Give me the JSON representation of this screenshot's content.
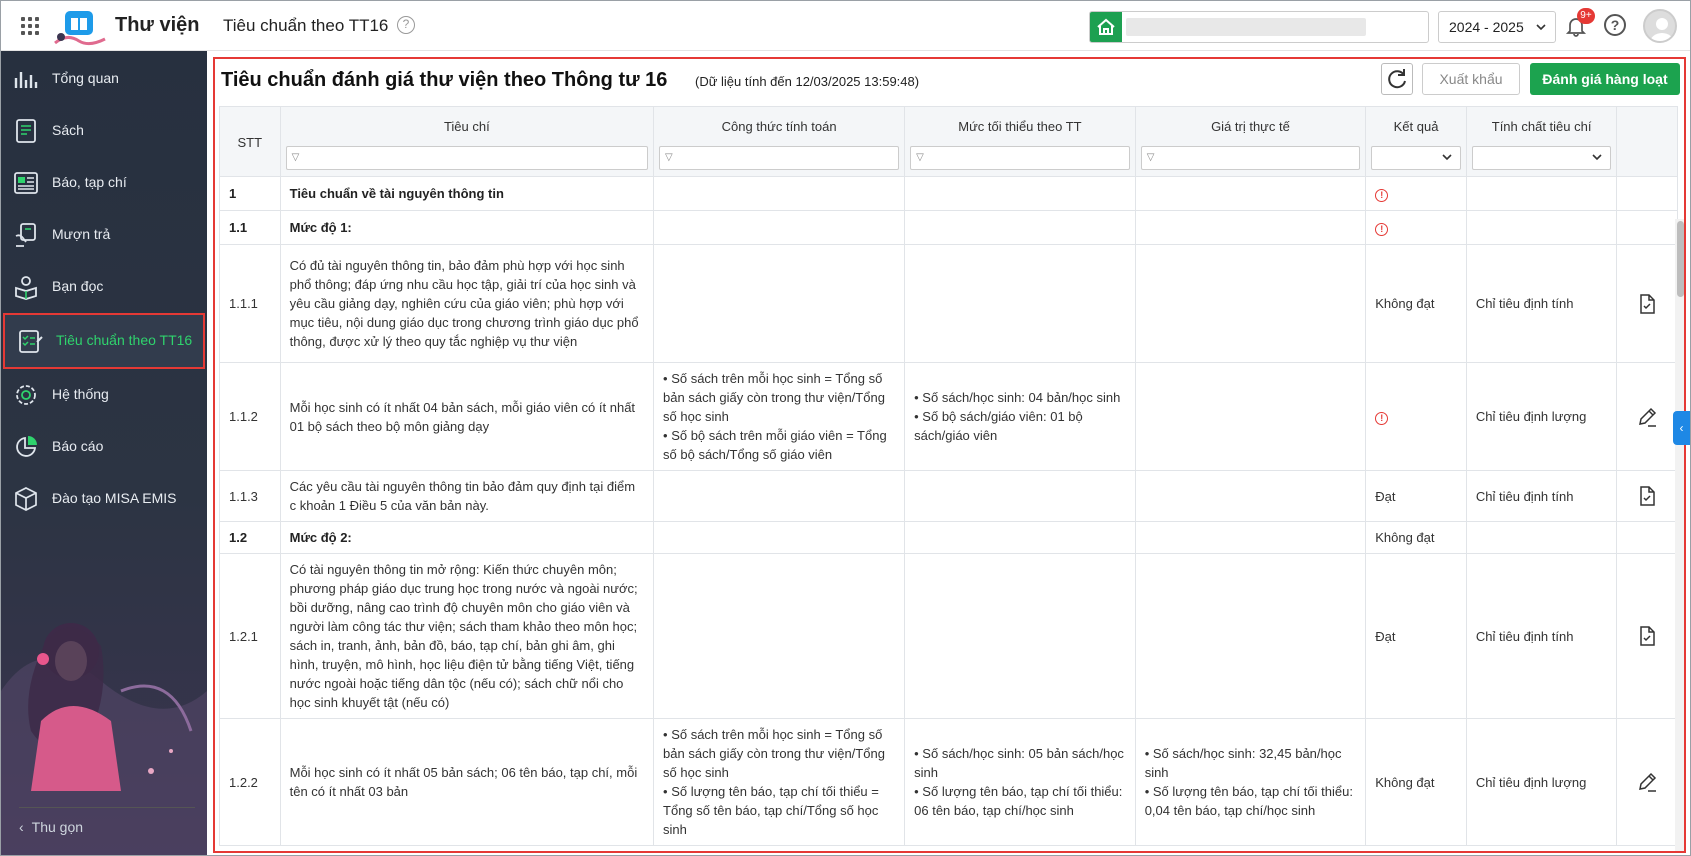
{
  "header": {
    "app_name": "Thư viện",
    "page_title": "Tiêu chuẩn theo TT16",
    "help_mark": "?",
    "school_year": "2024 - 2025",
    "notification_badge": "9+"
  },
  "sidebar": {
    "items": [
      {
        "label": "Tổng quan",
        "icon": "dashboard-icon"
      },
      {
        "label": "Sách",
        "icon": "book-icon"
      },
      {
        "label": "Báo, tạp chí",
        "icon": "newspaper-icon"
      },
      {
        "label": "Mượn trả",
        "icon": "borrow-icon"
      },
      {
        "label": "Bạn đọc",
        "icon": "reader-icon"
      },
      {
        "label": "Tiêu chuẩn theo TT16",
        "icon": "checklist-icon",
        "active": true
      },
      {
        "label": "Hệ thống",
        "icon": "gear-icon"
      },
      {
        "label": "Báo cáo",
        "icon": "pie-chart-icon"
      },
      {
        "label": "Đào tạo MISA EMIS",
        "icon": "box-icon"
      }
    ],
    "collapse_label": "Thu gọn",
    "active_color": "#2fd36d"
  },
  "main": {
    "title": "Tiêu chuẩn đánh giá thư viện theo Thông tư 16",
    "subtitle": "(Dữ liệu tính đến 12/03/2025 13:59:48)",
    "export_label": "Xuất khẩu",
    "evaluate_label": "Đánh giá hàng loạt",
    "accent_color": "#1ca34f"
  },
  "table": {
    "columns": {
      "stt": "STT",
      "criteria": "Tiêu chí",
      "formula": "Công thức tính toán",
      "minimum": "Mức tối thiểu theo TT",
      "actual": "Giá trị thực tế",
      "result": "Kết quả",
      "nature": "Tính chất tiêu chí"
    },
    "rows": [
      {
        "stt": "1",
        "criteria": "Tiêu chuẩn về tài nguyên thông tin",
        "formula": "",
        "minimum": "",
        "actual": "",
        "result": "",
        "result_warning": true,
        "nature": "",
        "action": "",
        "bold": true
      },
      {
        "stt": "1.1",
        "criteria": "Mức độ 1:",
        "formula": "",
        "minimum": "",
        "actual": "",
        "result": "",
        "result_warning": true,
        "nature": "",
        "action": "",
        "bold": true
      },
      {
        "stt": "1.1.1",
        "criteria": "Có đủ tài nguyên thông tin, bảo đảm phù hợp với học sinh phổ thông; đáp ứng nhu cầu học tập, giải trí của học sinh và yêu cầu giảng dạy, nghiên cứu của giáo viên; phù hợp với mục tiêu, nội dung giáo dục trong chương trình giáo dục phổ thông, được xử lý theo quy tắc nghiệp vụ thư viện",
        "formula": "",
        "minimum": "",
        "actual": "",
        "result": "Không đạt",
        "result_warning": false,
        "nature": "Chỉ tiêu định tính",
        "action": "check-document-icon",
        "bold": false
      },
      {
        "stt": "1.1.2",
        "criteria": "Mỗi học sinh có ít nhất 04 bản sách, mỗi giáo viên có ít nhất 01 bộ sách theo bộ môn giảng dạy",
        "formula": "• Số sách trên mỗi học sinh = Tổng số bản sách giấy còn trong thư viện/Tổng số học sinh\n• Số bộ sách trên mỗi giáo viên = Tổng số bộ sách/Tổng số giáo viên",
        "minimum": "• Số sách/học sinh: 04 bản/học sinh\n• Số bộ sách/giáo viên: 01 bộ sách/giáo viên",
        "actual": "",
        "result": "",
        "result_warning": true,
        "nature": "Chỉ tiêu định lượng",
        "action": "edit-pencil-icon",
        "bold": false
      },
      {
        "stt": "1.1.3",
        "criteria": "Các yêu cầu tài nguyên thông tin bảo đảm quy định tại điểm c khoản 1 Điều 5 của văn bản này.",
        "formula": "",
        "minimum": "",
        "actual": "",
        "result": "Đạt",
        "result_warning": false,
        "nature": "Chỉ tiêu định tính",
        "action": "check-document-icon",
        "bold": false
      },
      {
        "stt": "1.2",
        "criteria": "Mức độ 2:",
        "formula": "",
        "minimum": "",
        "actual": "",
        "result": "Không đạt",
        "result_warning": false,
        "nature": "",
        "action": "",
        "bold": true
      },
      {
        "stt": "1.2.1",
        "criteria": "Có tài nguyên thông tin mở rộng: Kiến thức chuyên môn; phương pháp giáo dục trung học trong nước và ngoài nước; bồi dưỡng, nâng cao trình độ chuyên môn cho giáo viên và người làm công tác thư viện; sách tham khảo theo môn học; sách in, tranh, ảnh, bản đồ, báo, tạp chí, bản ghi âm, ghi hình, truyện, mô hình, học liệu điện tử bằng tiếng Việt, tiếng nước ngoài hoặc tiếng dân tộc (nếu có); sách chữ nổi cho học sinh khuyết tật (nếu có)",
        "formula": "",
        "minimum": "",
        "actual": "",
        "result": "Đạt",
        "result_warning": false,
        "nature": "Chỉ tiêu định tính",
        "action": "check-document-icon",
        "bold": false
      },
      {
        "stt": "1.2.2",
        "criteria": "Mỗi học sinh có ít nhất 05 bản sách; 06 tên báo, tạp chí, mỗi tên có ít nhất 03 bản",
        "formula": "• Số sách trên mỗi học sinh = Tổng số bản sách giấy còn trong thư viện/Tổng số học sinh\n• Số lượng tên báo, tạp chí tối thiểu = Tổng số tên báo, tạp chí/Tổng số học sinh",
        "minimum": "• Số sách/học sinh: 05 bản sách/học sinh\n• Số lượng tên báo, tạp chí tối thiểu: 06 tên báo, tạp chí/học sinh",
        "actual": "• Số sách/học sinh: 32,45 bản/học sinh\n• Số lượng tên báo, tạp chí tối thiểu: 0,04 tên báo, tạp chí/học sinh",
        "result": "Không đạt",
        "result_warning": false,
        "nature": "Chỉ tiêu định lượng",
        "action": "edit-pencil-icon",
        "bold": false
      }
    ]
  }
}
